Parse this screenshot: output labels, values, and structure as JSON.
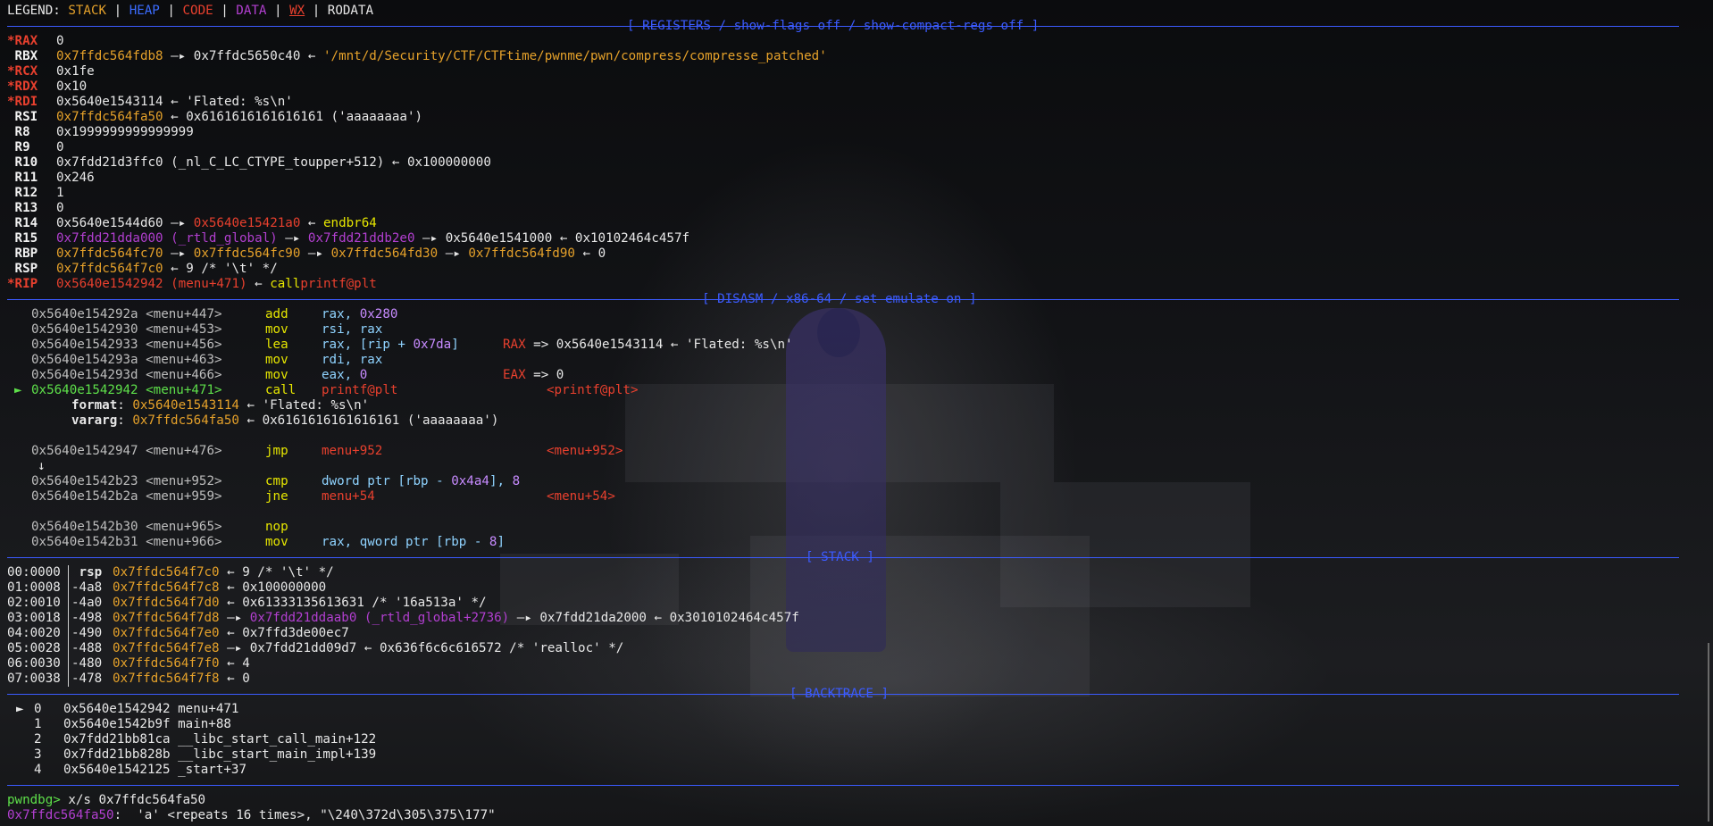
{
  "legend": {
    "label": "LEGEND:",
    "stack": "STACK",
    "heap": "HEAP",
    "code": "CODE",
    "data": "DATA",
    "wx": "WX",
    "rodata": "RODATA"
  },
  "headers": {
    "registers": "[ REGISTERS / show-flags off / show-compact-regs off ]",
    "disasm": "[ DISASM / x86-64 / set emulate on ]",
    "stack": "[ STACK ]",
    "backtrace": "[ BACKTRACE ]"
  },
  "registers": [
    {
      "name": "*RAX",
      "v1": "0"
    },
    {
      "name": " RBX",
      "v1": "0x7ffdc564fdb8",
      "a1": "—▸",
      "v2": "0x7ffdc5650c40",
      "a2": "←",
      "v3": "'/mnt/d/Security/CTF/CTFtime/pwnme/pwn/compress/compresse_patched'"
    },
    {
      "name": "*RCX",
      "v1": "0x1fe"
    },
    {
      "name": "*RDX",
      "v1": "0x10"
    },
    {
      "name": "*RDI",
      "v1": "0x5640e1543114",
      "a1": "←",
      "v2": "'Flated: %s\\n'"
    },
    {
      "name": " RSI",
      "v1": "0x7ffdc564fa50",
      "a1": "←",
      "v2": "0x6161616161616161 ('aaaaaaaa')"
    },
    {
      "name": " R8",
      "v1": "0x1999999999999999"
    },
    {
      "name": " R9",
      "v1": "0"
    },
    {
      "name": " R10",
      "v1": "0x7fdd21d3ffc0 (_nl_C_LC_CTYPE_toupper+512)",
      "a1": "←",
      "v2": "0x100000000"
    },
    {
      "name": " R11",
      "v1": "0x246"
    },
    {
      "name": " R12",
      "v1": "1"
    },
    {
      "name": " R13",
      "v1": "0"
    },
    {
      "name": " R14",
      "v1": "0x5640e1544d60",
      "a1": "—▸",
      "v2": "0x5640e15421a0",
      "a2": "←",
      "v3": "endbr64"
    },
    {
      "name": " R15",
      "v1": "0x7fdd21dda000 (_rtld_global)",
      "a1": "—▸",
      "v2": "0x7fdd21ddb2e0",
      "a2": "—▸",
      "v3": "0x5640e1541000",
      "a3": "←",
      "v4": "0x10102464c457f"
    },
    {
      "name": " RBP",
      "v1": "0x7ffdc564fc70",
      "a1": "—▸",
      "v2": "0x7ffdc564fc90",
      "a2": "—▸",
      "v3": "0x7ffdc564fd30",
      "a3": "—▸",
      "v4": "0x7ffdc564fd90",
      "a4": "←",
      "v5": "0"
    },
    {
      "name": " RSP",
      "v1": "0x7ffdc564f7c0",
      "a1": "←",
      "v2": "9 /* '\\t' */"
    },
    {
      "name": "*RIP",
      "v1": "0x5640e1542942 (menu+471)",
      "a1": "←",
      "v2": "call",
      "v3": "printf@plt"
    }
  ],
  "disasm": [
    {
      "addr": "0x5640e154292a",
      "sym": "<menu+447>",
      "mn": "add",
      "ops": "rax, ",
      "imm": "0x280"
    },
    {
      "addr": "0x5640e1542930",
      "sym": "<menu+453>",
      "mn": "mov",
      "ops": "rsi, rax"
    },
    {
      "addr": "0x5640e1542933",
      "sym": "<menu+456>",
      "mn": "lea",
      "ops": "rax, [rip + ",
      "imm": "0x7da",
      "ops2": "]",
      "cmt_reg": "RAX",
      "cmt": "=> 0x5640e1543114 ← 'Flated: %s\\n'"
    },
    {
      "addr": "0x5640e154293a",
      "sym": "<menu+463>",
      "mn": "mov",
      "ops": "rdi, rax"
    },
    {
      "addr": "0x5640e154293d",
      "sym": "<menu+466>",
      "mn": "mov",
      "ops": "eax, ",
      "imm": "0",
      "cmt_reg": "EAX",
      "cmt": "=> 0"
    },
    {
      "addr": "0x5640e1542942",
      "sym": "<menu+471>",
      "mn": "call",
      "target": "printf@plt",
      "cmt_sym": "<printf@plt>",
      "current": true,
      "marker": "►"
    }
  ],
  "call_args": [
    {
      "label": "format",
      "val": "0x5640e1543114",
      "rest": "← 'Flated: %s\\n'"
    },
    {
      "label": "vararg",
      "val": "0x7ffdc564fa50",
      "rest": "← 0x6161616161616161 ('aaaaaaaa')"
    }
  ],
  "disasm2": [
    {
      "addr": "0x5640e1542947",
      "sym": "<menu+476>",
      "mn": "jmp",
      "target": "menu+952",
      "cmt_sym": "<menu+952>"
    }
  ],
  "disasm_arrow": "↓",
  "disasm3": [
    {
      "addr": "0x5640e1542b23",
      "sym": "<menu+952>",
      "mn": "cmp",
      "ops": "dword ptr [rbp - ",
      "imm": "0x4a4",
      "ops2": "], ",
      "imm2": "8"
    },
    {
      "addr": "0x5640e1542b2a",
      "sym": "<menu+959>",
      "mn": "jne",
      "target": "menu+54",
      "cmt_sym": "<menu+54>"
    }
  ],
  "disasm4": [
    {
      "addr": "0x5640e1542b30",
      "sym": "<menu+965>",
      "mn": "nop"
    },
    {
      "addr": "0x5640e1542b31",
      "sym": "<menu+966>",
      "mn": "mov",
      "ops": "rax, qword ptr [rbp - ",
      "imm": "8",
      "ops2": "]"
    }
  ],
  "stack": [
    {
      "idx": "00:0000",
      "off": " rsp",
      "addr": "0x7ffdc564f7c0",
      "rest": "← 9 /* '\\t' */"
    },
    {
      "idx": "01:0008",
      "off": "-4a8",
      "addr": "0x7ffdc564f7c8",
      "rest": "← 0x100000000"
    },
    {
      "idx": "02:0010",
      "off": "-4a0",
      "addr": "0x7ffdc564f7d0",
      "rest": "← 0x61333135613631 /* '16a513a' */"
    },
    {
      "idx": "03:0018",
      "off": "-498",
      "addr": "0x7ffdc564f7d8",
      "arrow": "—▸",
      "daddr": "0x7fdd21ddaab0 (_rtld_global+2736)",
      "rest": "—▸ 0x7fdd21da2000 ← 0x3010102464c457f"
    },
    {
      "idx": "04:0020",
      "off": "-490",
      "addr": "0x7ffdc564f7e0",
      "rest": "← 0x7ffd3de00ec7"
    },
    {
      "idx": "05:0028",
      "off": "-488",
      "addr": "0x7ffdc564f7e8",
      "rest": "—▸ 0x7fdd21dd09d7 ← 0x636f6c6c616572 /* 'realloc' */"
    },
    {
      "idx": "06:0030",
      "off": "-480",
      "addr": "0x7ffdc564f7f0",
      "rest": "← 4"
    },
    {
      "idx": "07:0038",
      "off": "-478",
      "addr": "0x7ffdc564f7f8",
      "rest": "← 0"
    }
  ],
  "backtrace": [
    {
      "mark": "►",
      "n": "0",
      "addr": "0x5640e1542942",
      "sym": "menu+471"
    },
    {
      "mark": " ",
      "n": "1",
      "addr": "0x5640e1542b9f",
      "sym": "main+88"
    },
    {
      "mark": " ",
      "n": "2",
      "addr": "0x7fdd21bb81ca",
      "sym": "__libc_start_call_main+122"
    },
    {
      "mark": " ",
      "n": "3",
      "addr": "0x7fdd21bb828b",
      "sym": "__libc_start_main_impl+139"
    },
    {
      "mark": " ",
      "n": "4",
      "addr": "0x5640e1542125",
      "sym": "_start+37"
    }
  ],
  "prompt": {
    "ps": "pwndbg>",
    "cmd": " x/s 0x7ffdc564fa50"
  },
  "output": {
    "addr": "0x7ffdc564fa50",
    "rest": ":  'a' <repeats 16 times>, \"\\240\\372d\\305\\375\\177\""
  },
  "colors": {
    "stack": "#e5a12a",
    "heap": "#3b6cff",
    "code": "#e8402e",
    "data": "#b23fd0",
    "rule": "#3b5bff",
    "mnemonic": "#e6e600",
    "current": "#5ee04a"
  }
}
